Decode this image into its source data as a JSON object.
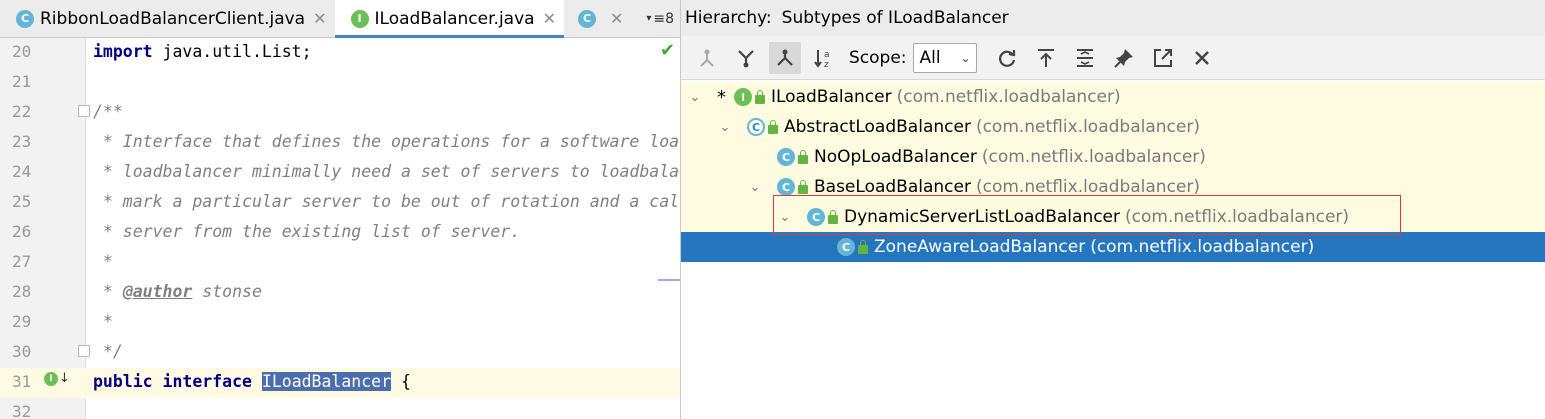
{
  "editor": {
    "tabs": [
      {
        "label": "RibbonLoadBalancerClient.java",
        "icon": "class-icon",
        "active": false
      },
      {
        "label": "ILoadBalancer.java",
        "icon": "interface-icon",
        "active": true
      },
      {
        "label": "",
        "icon": "class-icon",
        "active": false
      }
    ],
    "tabs_more": "≡8",
    "lines": [
      {
        "num": "20",
        "text": "import java.util.List;"
      },
      {
        "num": "21",
        "text": ""
      },
      {
        "num": "22",
        "text": "/**"
      },
      {
        "num": "23",
        "text": " * Interface that defines the operations for a software loa"
      },
      {
        "num": "24",
        "text": " * loadbalancer minimally need a set of servers to loadbala"
      },
      {
        "num": "25",
        "text": " * mark a particular server to be out of rotation and a cal"
      },
      {
        "num": "26",
        "text": " * server from the existing list of server."
      },
      {
        "num": "27",
        "text": " *"
      },
      {
        "num": "28",
        "text": " * @author stonse"
      },
      {
        "num": "29",
        "text": " *"
      },
      {
        "num": "30",
        "text": " */"
      },
      {
        "num": "31",
        "text": "public interface ILoadBalancer {"
      },
      {
        "num": "32",
        "text": ""
      }
    ],
    "selected_identifier": "ILoadBalancer"
  },
  "hierarchy": {
    "title": "Hierarchy:",
    "subtitle": "Subtypes of ILoadBalancer",
    "scope_label": "Scope:",
    "scope_value": "All",
    "tree": [
      {
        "name": "ILoadBalancer",
        "pkg": "(com.netflix.loadbalancer)",
        "depth": 0,
        "kind": "interface",
        "expanded": true,
        "star": true
      },
      {
        "name": "AbstractLoadBalancer",
        "pkg": "(com.netflix.loadbalancer)",
        "depth": 1,
        "kind": "abstract",
        "expanded": true
      },
      {
        "name": "NoOpLoadBalancer",
        "pkg": "(com.netflix.loadbalancer)",
        "depth": 2,
        "kind": "class",
        "expanded": null
      },
      {
        "name": "BaseLoadBalancer",
        "pkg": "(com.netflix.loadbalancer)",
        "depth": 2,
        "kind": "class",
        "expanded": true
      },
      {
        "name": "DynamicServerListLoadBalancer",
        "pkg": "(com.netflix.loadbalancer)",
        "depth": 3,
        "kind": "class",
        "expanded": true
      },
      {
        "name": "ZoneAwareLoadBalancer",
        "pkg": "(com.netflix.loadbalancer)",
        "depth": 4,
        "kind": "class",
        "expanded": null,
        "selected": true
      }
    ]
  }
}
